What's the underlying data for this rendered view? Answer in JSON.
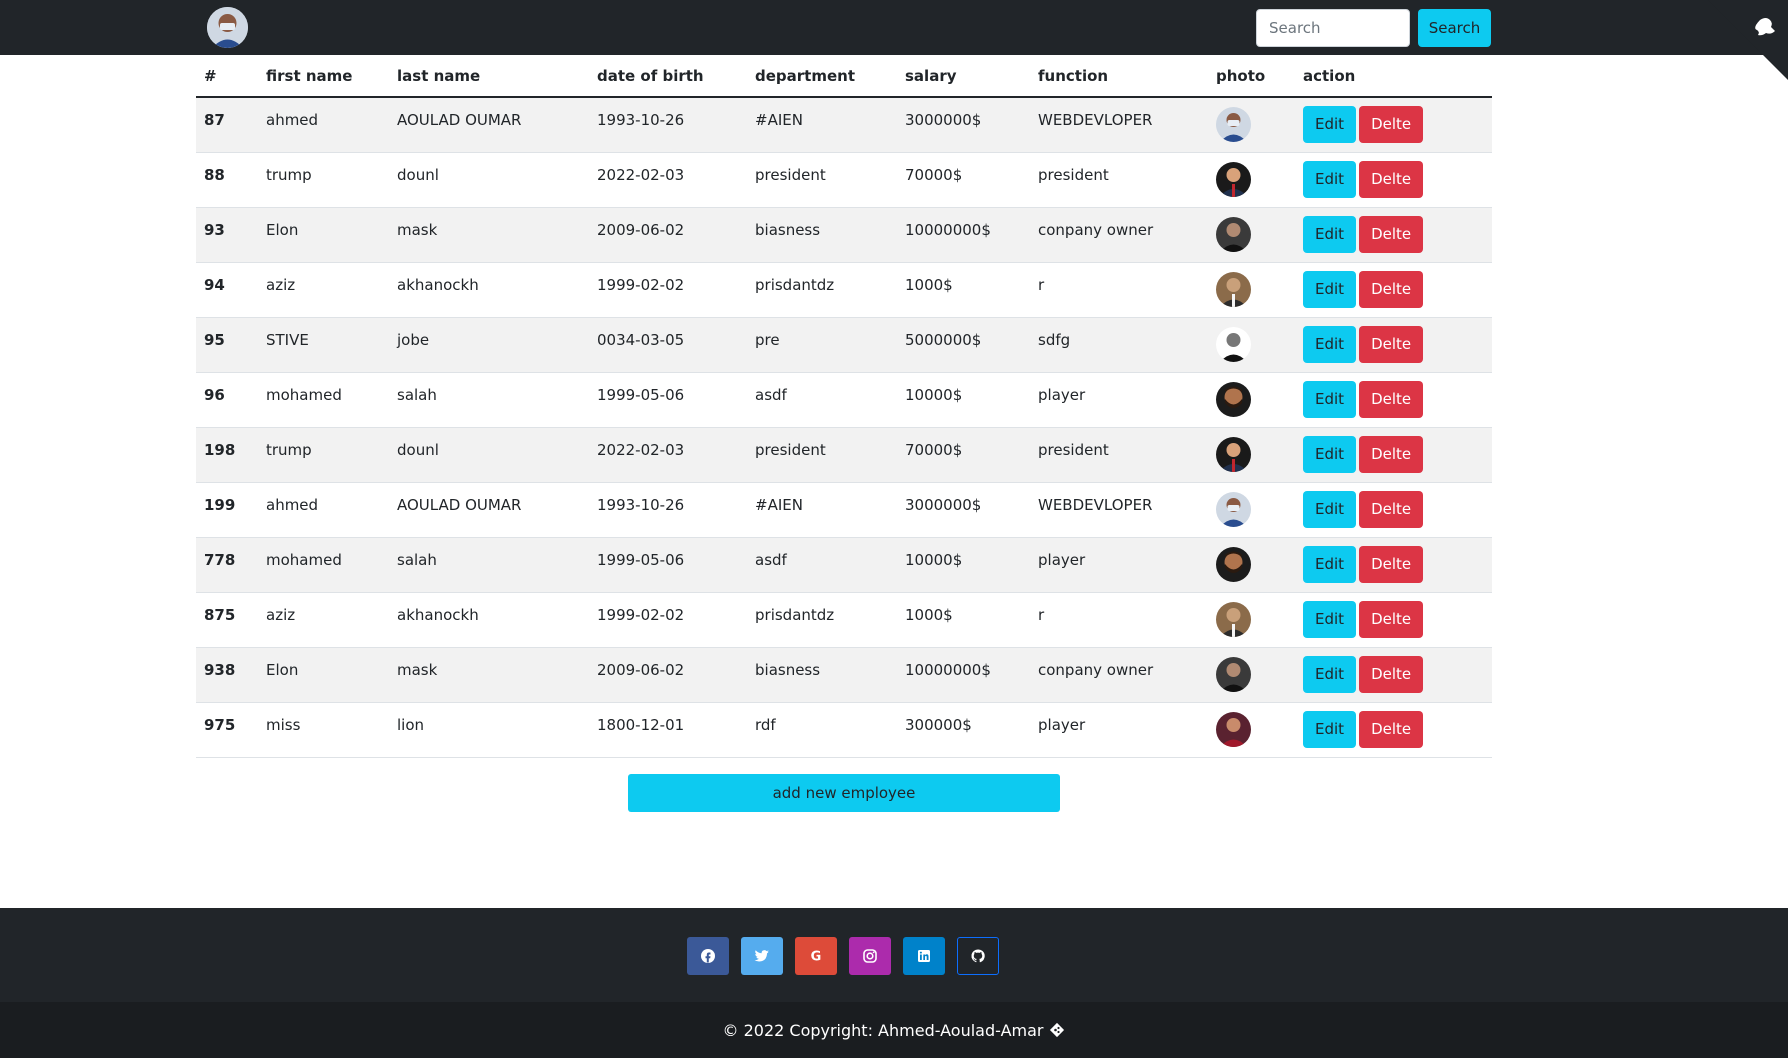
{
  "navbar": {
    "search_placeholder": "Search",
    "search_button": "Search"
  },
  "table": {
    "headers": [
      "#",
      "first name",
      "last name",
      "date of birth",
      "department",
      "salary",
      "function",
      "photo",
      "action"
    ],
    "rows": [
      {
        "id": "87",
        "first": "ahmed",
        "last": "AOULAD OUMAR",
        "dob": "1993-10-26",
        "dept": "#AIEN",
        "salary": "3000000$",
        "func": "WEBDEVLOPER",
        "photo": "masked-man"
      },
      {
        "id": "88",
        "first": "trump",
        "last": "dounl",
        "dob": "2022-02-03",
        "dept": "president",
        "salary": "70000$",
        "func": "president",
        "photo": "suit-man"
      },
      {
        "id": "93",
        "first": "Elon",
        "last": "mask",
        "dob": "2009-06-02",
        "dept": "biasness",
        "salary": "10000000$",
        "func": "conpany owner",
        "photo": "dark-man"
      },
      {
        "id": "94",
        "first": "aziz",
        "last": "akhanockh",
        "dob": "1999-02-02",
        "dept": "prisdantdz",
        "salary": "1000$",
        "func": "r",
        "photo": "older-man"
      },
      {
        "id": "95",
        "first": "STIVE",
        "last": "jobe",
        "dob": "0034-03-05",
        "dept": "pre",
        "salary": "5000000$",
        "func": "sdfg",
        "photo": "bw-man"
      },
      {
        "id": "96",
        "first": "mohamed",
        "last": "salah",
        "dob": "1999-05-06",
        "dept": "asdf",
        "salary": "10000$",
        "func": "player",
        "photo": "bearded-man"
      },
      {
        "id": "198",
        "first": "trump",
        "last": "dounl",
        "dob": "2022-02-03",
        "dept": "president",
        "salary": "70000$",
        "func": "president",
        "photo": "suit-man"
      },
      {
        "id": "199",
        "first": "ahmed",
        "last": "AOULAD OUMAR",
        "dob": "1993-10-26",
        "dept": "#AIEN",
        "salary": "3000000$",
        "func": "WEBDEVLOPER",
        "photo": "masked-man"
      },
      {
        "id": "778",
        "first": "mohamed",
        "last": "salah",
        "dob": "1999-05-06",
        "dept": "asdf",
        "salary": "10000$",
        "func": "player",
        "photo": "bearded-man"
      },
      {
        "id": "875",
        "first": "aziz",
        "last": "akhanockh",
        "dob": "1999-02-02",
        "dept": "prisdantdz",
        "salary": "1000$",
        "func": "r",
        "photo": "older-man"
      },
      {
        "id": "938",
        "first": "Elon",
        "last": "mask",
        "dob": "2009-06-02",
        "dept": "biasness",
        "salary": "10000000$",
        "func": "conpany owner",
        "photo": "dark-man"
      },
      {
        "id": "975",
        "first": "miss",
        "last": "lion",
        "dob": "1800-12-01",
        "dept": "rdf",
        "salary": "300000$",
        "func": "player",
        "photo": "red-player"
      }
    ],
    "edit_label": "Edit",
    "delete_label": "Delte"
  },
  "add_button": "add new employee",
  "footer": {
    "social": [
      {
        "name": "facebook-icon",
        "color": "#3b5998"
      },
      {
        "name": "twitter-icon",
        "color": "#55acee"
      },
      {
        "name": "google-icon",
        "color": "#dd4b39"
      },
      {
        "name": "instagram-icon",
        "color": "#ac2bac"
      },
      {
        "name": "linkedin-icon",
        "color": "#0082ca"
      },
      {
        "name": "github-icon",
        "color": "#212529"
      }
    ],
    "copyright": "© 2022 Copyright: Ahmed-Aoulad-Amar"
  },
  "colors": {
    "navbar": "#212529",
    "info": "#0dcaf0",
    "danger": "#dc3545"
  }
}
